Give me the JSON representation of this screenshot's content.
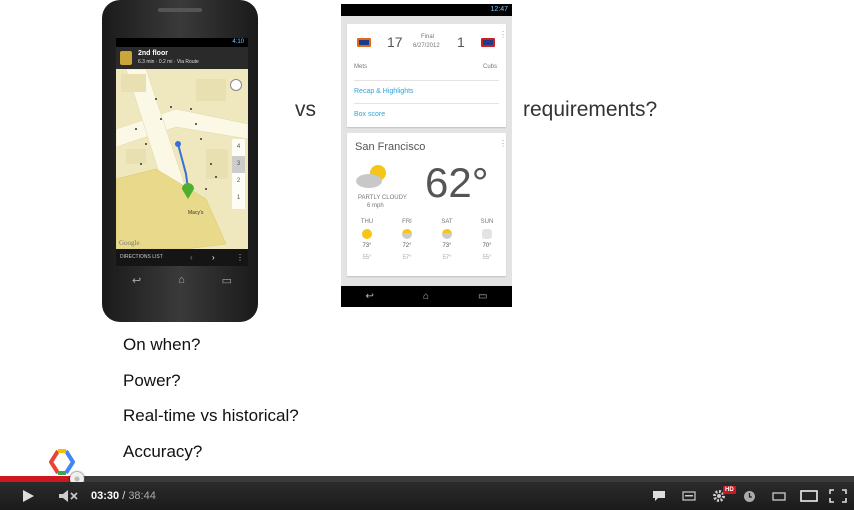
{
  "slide": {
    "vs_text": "vs",
    "requirements_text": "requirements?",
    "bullets": [
      "On when?",
      "Power?",
      "Real-time vs historical?",
      "Accuracy?"
    ]
  },
  "phone_maps": {
    "status_time": "4:10",
    "nav_title": "2nd floor",
    "nav_sub": "6.3 min · 0.2 mi · Via Route",
    "bottom_label": "DIRECTIONS LIST",
    "brand": "Google",
    "destination": "Macy's",
    "floors": [
      "4",
      "3",
      "2",
      "1"
    ]
  },
  "phone_now": {
    "status_time": "12:47",
    "sports": {
      "home_score": "17",
      "away_score": "1",
      "status": "Final",
      "date": "6/27/2012",
      "home_team": "Mets",
      "away_team": "Cubs",
      "link1": "Recap & Highlights",
      "link2": "Box score"
    },
    "weather": {
      "city": "San Francisco",
      "temp": "62°",
      "condition": "PARTLY CLOUDY",
      "wind": "6 mph",
      "forecast": [
        {
          "day": "THU",
          "hi": "73°",
          "lo": "55°",
          "icon": "sun-icon"
        },
        {
          "day": "FRI",
          "hi": "72°",
          "lo": "57°",
          "icon": "partly-cloudy-icon"
        },
        {
          "day": "SAT",
          "hi": "73°",
          "lo": "57°",
          "icon": "partly-cloudy-icon"
        },
        {
          "day": "SUN",
          "hi": "70°",
          "lo": "55°",
          "icon": "cloud-icon"
        }
      ]
    }
  },
  "player": {
    "current_time": "03:30",
    "separator": " / ",
    "total_time": "38:44",
    "played_fraction": 0.0904,
    "loaded_fraction": 0.1,
    "hd_badge": "HD",
    "accent": "#cc181e"
  }
}
